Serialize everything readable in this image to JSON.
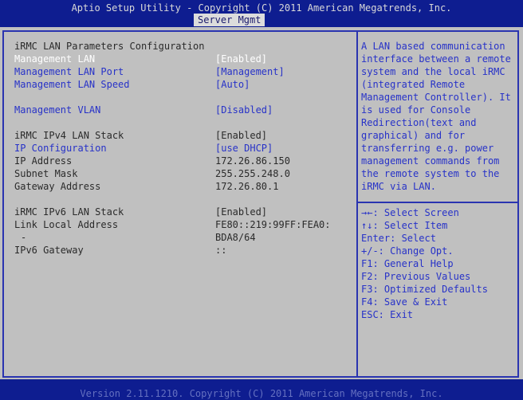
{
  "header": {
    "title": "Aptio Setup Utility - Copyright (C) 2011 American Megatrends, Inc.",
    "tab": "Server Mgmt"
  },
  "section_title": "iRMC LAN Parameters Configuration",
  "rows": [
    {
      "label": "Management LAN",
      "value": "[Enabled]"
    },
    {
      "label": "Management LAN Port",
      "value": "[Management]"
    },
    {
      "label": "Management LAN Speed",
      "value": "[Auto]"
    },
    {
      "label": "Management VLAN",
      "value": "[Disabled]"
    },
    {
      "label": "iRMC IPv4 LAN Stack",
      "value": "[Enabled]"
    },
    {
      "label": "IP Configuration",
      "value": "[use DHCP]"
    },
    {
      "label": "IP Address",
      "value": "172.26.86.150"
    },
    {
      "label": "Subnet Mask",
      "value": "255.255.248.0"
    },
    {
      "label": "Gateway Address",
      "value": "172.26.80.1"
    },
    {
      "label": "iRMC IPv6 LAN Stack",
      "value": "[Enabled]"
    },
    {
      "label": "Link Local Address",
      "value": "FE80::219:99FF:FEA0:"
    },
    {
      "label": "-",
      "value": "BDA8/64"
    },
    {
      "label": "IPv6 Gateway",
      "value": "::"
    }
  ],
  "help_text": "A LAN based communication interface between a remote system and the local iRMC (integrated Remote Management Controller). It is used for Console Redirection(text and graphical) and for transferring e.g. power management commands from the remote system to the iRMC via LAN.",
  "keys": [
    "→←: Select Screen",
    "↑↓: Select Item",
    "Enter: Select",
    "+/-: Change Opt.",
    "F1: General Help",
    "F2: Previous Values",
    "F3: Optimized Defaults",
    "F4: Save & Exit",
    "ESC: Exit"
  ],
  "footer": "Version 2.11.1210. Copyright (C) 2011 American Megatrends, Inc."
}
